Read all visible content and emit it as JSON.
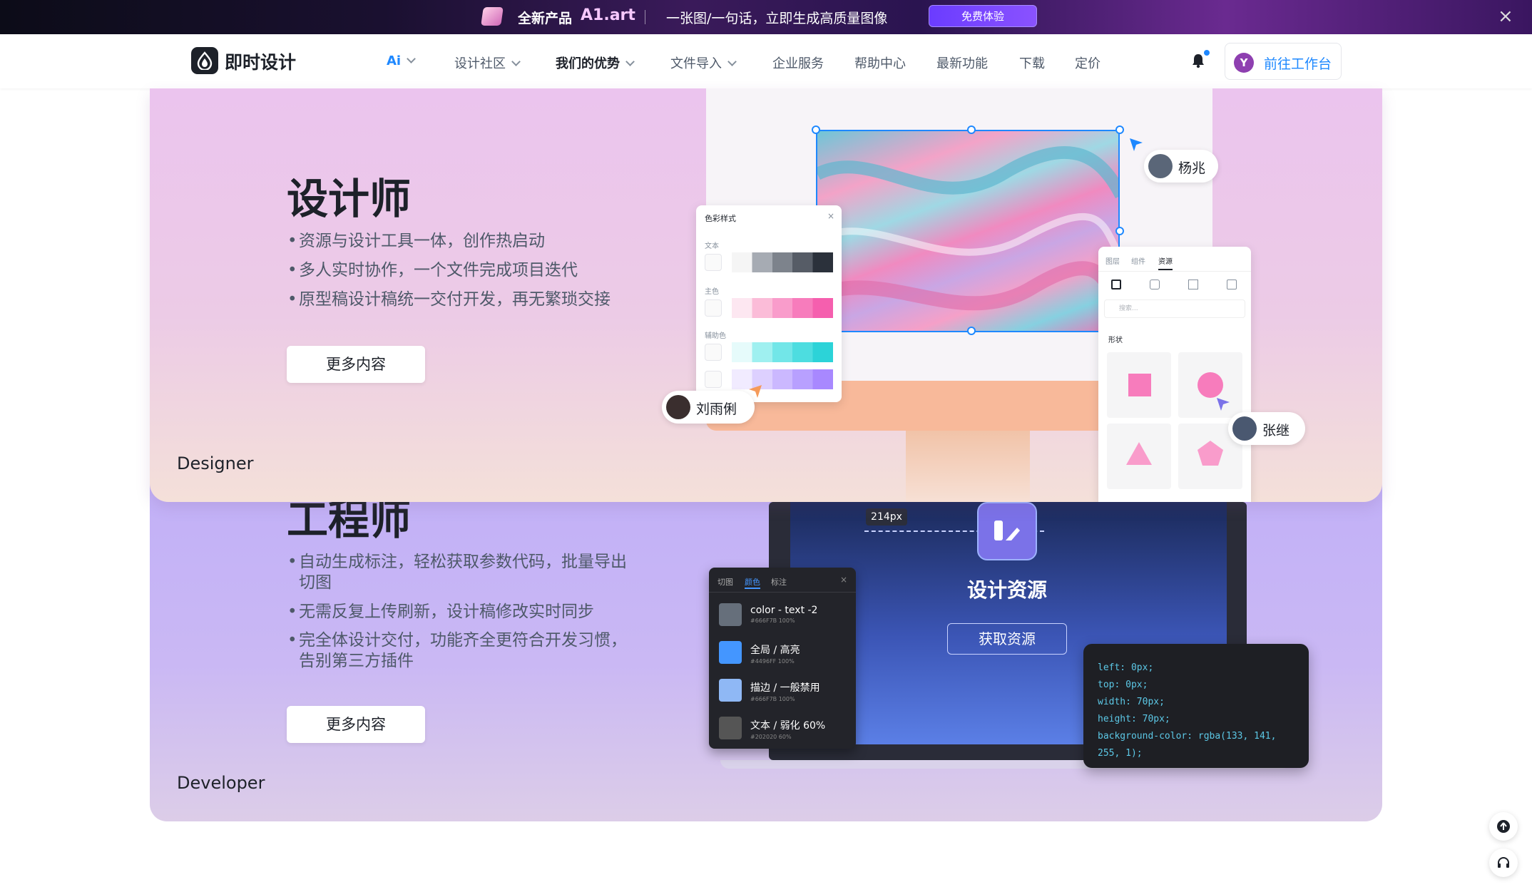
{
  "banner": {
    "product_prefix": "全新产品",
    "product_name": "A1.art",
    "slogan": "一张图/一句话，立即生成高质量图像",
    "cta": "免费体验",
    "close": "×"
  },
  "nav": {
    "logo": "即时设计",
    "items": [
      {
        "label": "Ai",
        "dropdown": true,
        "active": true
      },
      {
        "label": "设计社区",
        "dropdown": true
      },
      {
        "label": "我们的优势",
        "dropdown": true,
        "bold": true
      },
      {
        "label": "文件导入",
        "dropdown": true
      },
      {
        "label": "企业服务"
      },
      {
        "label": "帮助中心"
      },
      {
        "label": "最新功能"
      },
      {
        "label": "下载"
      },
      {
        "label": "定价"
      }
    ],
    "avatar_letter": "Y",
    "workspace_label": "前往工作台"
  },
  "designer": {
    "title": "设计师",
    "bullets": [
      "资源与设计工具一体，创作热启动",
      "多人实时协作，一个文件完成项目迭代",
      "原型稿设计稿统一交付开发，再无繁琐交接"
    ],
    "more": "更多内容",
    "tag": "Designer",
    "color_panel": {
      "title": "色彩样式",
      "close": "×",
      "groups": [
        "文本",
        "主色",
        "辅助色"
      ]
    },
    "assets_panel": {
      "tabs": [
        "图层",
        "组件",
        "资源"
      ],
      "search_placeholder": "搜索...",
      "section": "形状"
    },
    "collaborators": [
      "杨兆",
      "刘雨俐",
      "张继"
    ]
  },
  "developer": {
    "title": "工程师",
    "bullets": [
      "自动生成标注，轻松获取参数代码，批量导出切图",
      "无需反复上传刷新，设计稿修改实时同步",
      "完全体设计交付，功能齐全更符合开发习惯，告别第三方插件"
    ],
    "more": "更多内容",
    "tag": "Developer",
    "measure": "214px",
    "screen_title": "设计资源",
    "screen_button": "获取资源",
    "token_panel": {
      "tabs": [
        "切图",
        "颜色",
        "标注"
      ],
      "close": "×",
      "tokens": [
        {
          "name": "color - text -2",
          "meta": "#666F7B 100%",
          "color": "#666f7b"
        },
        {
          "name": "全局 / 高亮",
          "meta": "#4496FF 100%",
          "color": "#4496ff"
        },
        {
          "name": "描边 / 一般禁用",
          "meta": "#666F7B 100%",
          "color": "#8fb8f5"
        },
        {
          "name": "文本 / 弱化 60%",
          "meta": "#202020 60%",
          "color": "#555555"
        }
      ]
    },
    "code": [
      "left: 0px;",
      "top: 0px;",
      "width: 70px;",
      "height: 70px;",
      "background-color: rgba(133, 141,",
      "255, 1);"
    ]
  },
  "colors": {
    "accent": "#1e88ff",
    "text": "#1d2129"
  }
}
